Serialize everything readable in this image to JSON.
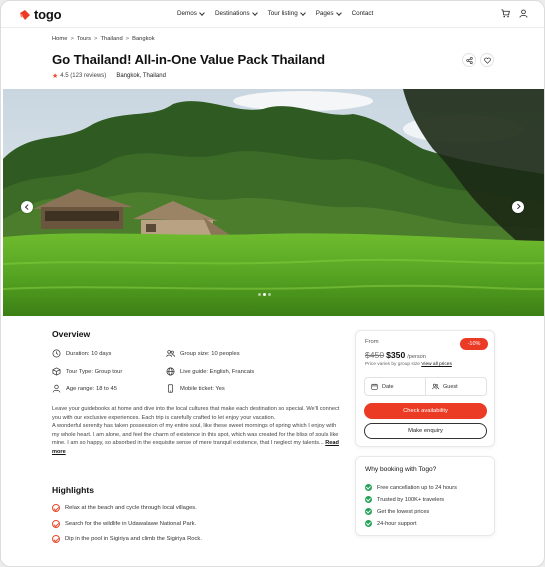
{
  "brand": {
    "name": "togo",
    "accent": "#eb3b24"
  },
  "nav": {
    "items": [
      {
        "label": "Demos",
        "has_dropdown": true
      },
      {
        "label": "Destinations",
        "has_dropdown": true
      },
      {
        "label": "Tour listing",
        "has_dropdown": true
      },
      {
        "label": "Pages",
        "has_dropdown": true
      },
      {
        "label": "Contact",
        "has_dropdown": false
      }
    ],
    "icons": [
      "cart-icon",
      "user-icon"
    ]
  },
  "breadcrumb": [
    "Home",
    "Tours",
    "Thailand",
    "Bangkok"
  ],
  "breadcrumb_separator": ">",
  "tour": {
    "title": "Go Thailand! All-in-One Value Pack Thailand",
    "rating": "4.5",
    "reviews": "(123 reviews)",
    "location": "Bangkok, Thailand"
  },
  "hero": {
    "slide_count": 3,
    "active_slide": 2
  },
  "overview": {
    "heading": "Overview",
    "features": [
      {
        "icon": "clock-icon",
        "label": "Duration: 10 days"
      },
      {
        "icon": "users-icon",
        "label": "Group size: 10 peoples"
      },
      {
        "icon": "box-icon",
        "label": "Tour Type: Group tour"
      },
      {
        "icon": "globe-icon",
        "label": "Live guide: English, Francais"
      },
      {
        "icon": "user-icon",
        "label": "Age range: 18 to 45"
      },
      {
        "icon": "phone-icon",
        "label": "Mobile ticket: Yes"
      }
    ],
    "paragraph1": "Leave your guidebooks at home and dive into the local cultures that make each destination so special. We'll connect you with our exclusive experiences. Each trip is carefully crafted to let enjoy your vacation.",
    "paragraph2": "A wonderful serenity has taken possession of my entire soul, like these sweet mornings of spring which I enjoy with my whole heart. I am alone, and feel the charm of existence in this spot, which was created for the bliss of souls like mine. I am so happy, so absorbed in the exquisite sense of mere tranquil existence, that I neglect my talents...",
    "read_more": "Read more"
  },
  "highlights": {
    "heading": "Highlights",
    "items": [
      "Relax at the beach and cycle through local villages.",
      "Search for the wildlife in Udawalawe National Park.",
      "Dip in the pool in Sigiriya and climb the Sigiriya Rock."
    ]
  },
  "booking": {
    "from_label": "From",
    "discount": "-10%",
    "old_price": "$450",
    "new_price": "$350",
    "per": "/person",
    "note": "Price varies by group size",
    "view_prices": "View all prices",
    "date_label": "Date",
    "guest_label": "Guest",
    "check_button": "Check availability",
    "enquiry_button": "Make enquiry"
  },
  "why": {
    "title": "Why booking with Togo?",
    "items": [
      "Free cancellation up to 24 hours",
      "Trusted by 100K+ travelers",
      "Get the lowest prices",
      "24-hour support"
    ],
    "check_color": "#25a35a"
  }
}
